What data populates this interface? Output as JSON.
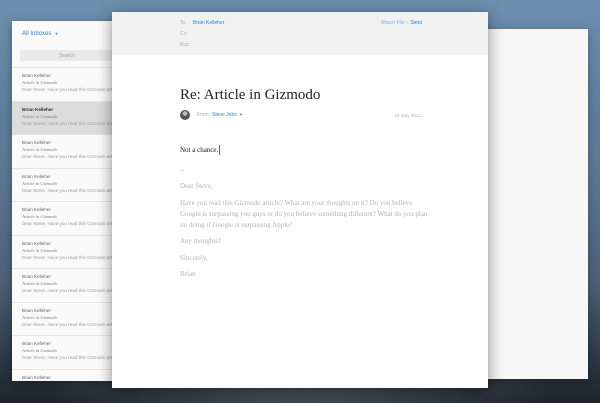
{
  "inbox": {
    "title": "All Inboxes",
    "chevron_icon": "chevron-down-icon",
    "search_placeholder": "Search",
    "messages": [
      {
        "from": "Brian Kelleher",
        "subject": "Article in Gizmodo",
        "preview": "Dear Steve, Have you read this Gizmodo article?"
      },
      {
        "from": "Brian Kelleher",
        "subject": "Article in Gizmodo",
        "preview": "Dear Steve, Have you read this Gizmodo article?"
      },
      {
        "from": "Brian Kelleher",
        "subject": "Article in Gizmodo",
        "preview": "Dear Steve, Have you read this Gizmodo article?"
      },
      {
        "from": "Brian Kelleher",
        "subject": "Article in Gizmodo",
        "preview": "Dear Steve, Have you read this Gizmodo article?"
      },
      {
        "from": "Brian Kelleher",
        "subject": "Article in Gizmodo",
        "preview": "Dear Steve, Have you read this Gizmodo article?"
      },
      {
        "from": "Brian Kelleher",
        "subject": "Article in Gizmodo",
        "preview": "Dear Steve, Have you read this Gizmodo article?"
      },
      {
        "from": "Brian Kelleher",
        "subject": "Article in Gizmodo",
        "preview": "Dear Steve, Have you read this Gizmodo article?"
      },
      {
        "from": "Brian Kelleher",
        "subject": "Article in Gizmodo",
        "preview": "Dear Steve, Have you read this Gizmodo article?"
      },
      {
        "from": "Brian Kelleher",
        "subject": "Article in Gizmodo",
        "preview": "Dear Steve, Have you read this Gizmodo article?"
      },
      {
        "from": "Brian Kelleher",
        "subject": "",
        "preview": ""
      }
    ]
  },
  "compose": {
    "to_label": "To:",
    "to_value": "Brian Kelleher",
    "cc_label": "Cc:",
    "bcc_label": "Bcc:",
    "attach_label": "Attach File",
    "separator": "•",
    "send_label": "Send",
    "subject": "Re: Article in Gizmodo",
    "from_label": "From:",
    "from_value": "Steve Jobs",
    "date": "24 May 2013",
    "reply_text": "Not a chance.",
    "quoted": {
      "marker": "--",
      "greeting": "Dear Steve,",
      "body": "Have you read this Gizmodo article? What are your thoughts on it? Do you believe Google is surpassing you guys or do you believe something different? What do you plan on doing if Google is surpassing Apple?",
      "question": "Any thoughts?",
      "signoff": "Sincerely,",
      "name": "Brian"
    }
  },
  "colors": {
    "accent": "#2f7fd4",
    "muted_text": "#b3b3b3",
    "header_bg": "#f1f1f1"
  }
}
